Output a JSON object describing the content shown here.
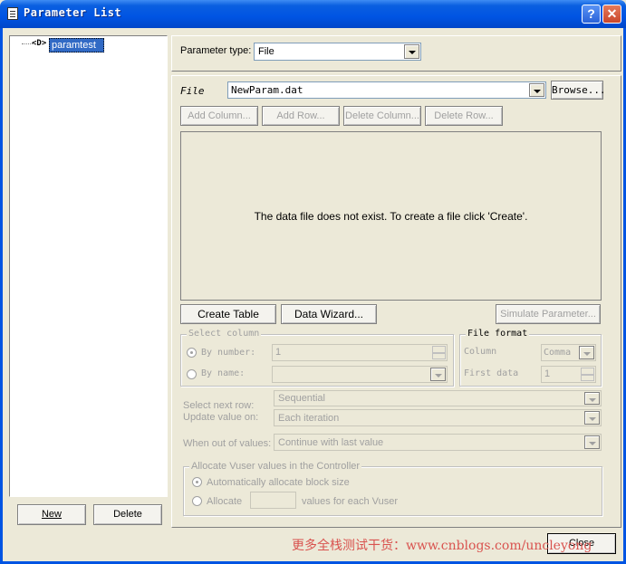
{
  "window": {
    "title": "Parameter List",
    "help_glyph": "?",
    "close_glyph": "✕"
  },
  "tree": {
    "node_glyph": "<D>",
    "item_label": "paramtest"
  },
  "left_buttons": {
    "new_label": "New",
    "delete_label": "Delete"
  },
  "param_type": {
    "label": "Parameter type:",
    "value": "File"
  },
  "file": {
    "label": "File",
    "value": "NewParam.dat",
    "browse_label": "Browse..."
  },
  "column_buttons": {
    "add_column": "Add Column...",
    "add_row": "Add Row...",
    "delete_column": "Delete Column...",
    "delete_row": "Delete Row..."
  },
  "data_area": {
    "message": "The data file does not exist. To create a file click 'Create'."
  },
  "action_buttons": {
    "create_table": "Create Table",
    "data_wizard": "Data Wizard...",
    "simulate": "Simulate Parameter..."
  },
  "select_column": {
    "legend": "Select column",
    "by_number_label": "By number:",
    "by_number_value": "1",
    "by_name_label": "By name:"
  },
  "file_format": {
    "legend": "File format",
    "column_label": "Column",
    "column_value": "Comma",
    "first_data_label": "First data",
    "first_data_value": "1"
  },
  "select_next_row": {
    "label": "Select next row:",
    "value": "Sequential"
  },
  "update_value": {
    "label": "Update value on:",
    "value": "Each iteration"
  },
  "out_of_values": {
    "label": "When out of values:",
    "value": "Continue with last value"
  },
  "allocate": {
    "legend": "Allocate Vuser values in the Controller",
    "auto_label": "Automatically allocate block size",
    "manual_label": "Allocate",
    "manual_suffix": "values for each Vuser"
  },
  "close_label": "Close",
  "watermark": "更多全栈测试干货：www.cnblogs.com/uncleyong"
}
